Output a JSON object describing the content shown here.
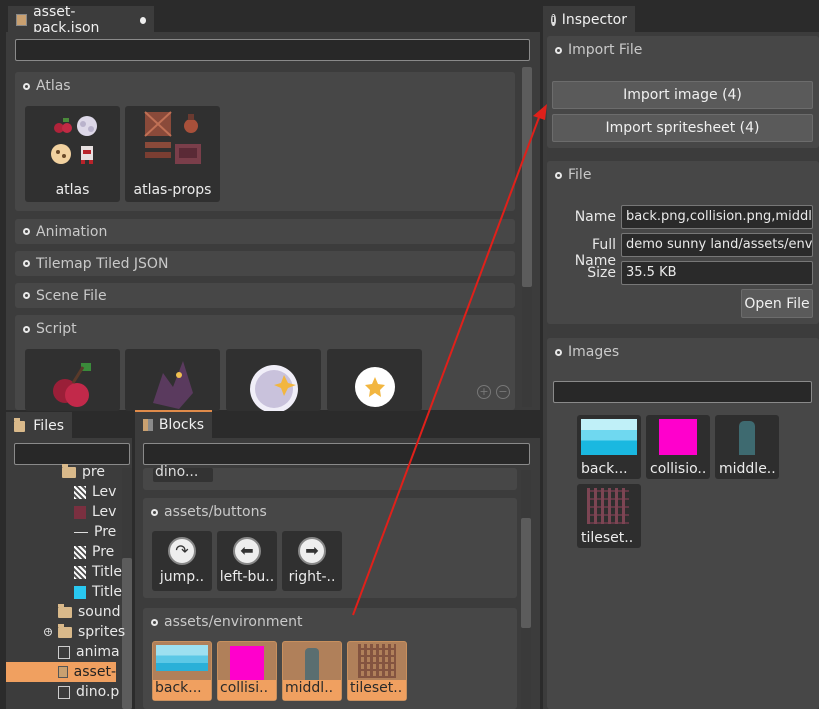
{
  "editor": {
    "tab_title": "asset-pack.json",
    "sections": [
      {
        "title": "Atlas",
        "expanded": true,
        "items": [
          "atlas",
          "atlas-props"
        ]
      },
      {
        "title": "Animation",
        "expanded": false
      },
      {
        "title": "Tilemap Tiled JSON",
        "expanded": false
      },
      {
        "title": "Scene File",
        "expanded": false
      },
      {
        "title": "Script",
        "expanded": true
      }
    ],
    "zoom_in_icon": "zoom-in-icon",
    "zoom_out_icon": "zoom-out-icon"
  },
  "files": {
    "tab_title": "Files",
    "tree": [
      {
        "label": "pre",
        "icon": "folder-icon"
      },
      {
        "label": "Lev",
        "icon": "tiled-icon"
      },
      {
        "label": "Lev",
        "icon": "sprite-icon"
      },
      {
        "label": "Pre",
        "icon": "dash-icon"
      },
      {
        "label": "Pre",
        "icon": "tiled-icon"
      },
      {
        "label": "Title",
        "icon": "tiled-icon"
      },
      {
        "label": "Title",
        "icon": "image-icon"
      },
      {
        "label": "sound",
        "icon": "folder-icon"
      },
      {
        "label": "sprites",
        "icon": "folder-icon"
      },
      {
        "label": "anima",
        "icon": "file-icon"
      },
      {
        "label": "asset-",
        "icon": "pack-icon",
        "selected": true
      },
      {
        "label": "dino.p",
        "icon": "file-icon"
      }
    ]
  },
  "blocks": {
    "tab_title": "Blocks",
    "partial_item": "dino...",
    "buttons_section": {
      "title": "assets/buttons",
      "items": [
        "jump..",
        "left-bu..",
        "right-.."
      ]
    },
    "environment_section": {
      "title": "assets/environment",
      "items": [
        "back...",
        "collisi..",
        "middl..",
        "tileset.."
      ]
    }
  },
  "inspector": {
    "tab_title": "Inspector",
    "import_file": {
      "title": "Import File",
      "import_image": "Import image (4)",
      "import_spritesheet": "Import spritesheet (4)"
    },
    "file": {
      "title": "File",
      "name_label": "Name",
      "name_value": "back.png,collision.png,middle.png,tileset.png",
      "fullname_label": "Full Name",
      "fullname_value": "demo sunny land/assets/environment",
      "size_label": "Size",
      "size_value": "35.5 KB",
      "open_file": "Open File"
    },
    "images": {
      "title": "Images",
      "items": [
        "back...",
        "collisio..",
        "middle..",
        "tileset.."
      ]
    }
  },
  "colors": {
    "accent_orange": "#f0a060",
    "arrow_red": "#e0201a",
    "magenta": "#ff00cc",
    "cyan": "#29c8f0"
  }
}
